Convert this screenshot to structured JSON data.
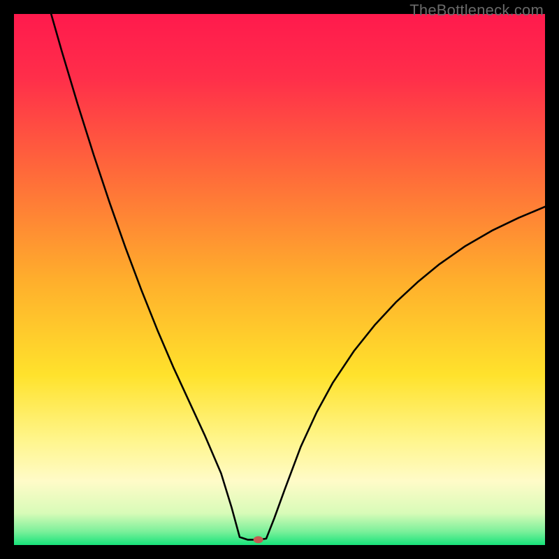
{
  "watermark": "TheBottleneck.com",
  "chart_data": {
    "type": "line",
    "title": "",
    "xlabel": "",
    "ylabel": "",
    "xlim": [
      0,
      100
    ],
    "ylim": [
      0,
      100
    ],
    "grid": false,
    "legend": false,
    "background_gradient_stops": [
      {
        "offset": 0.0,
        "color": "#ff1a4d"
      },
      {
        "offset": 0.12,
        "color": "#ff2e4a"
      },
      {
        "offset": 0.3,
        "color": "#ff6a3a"
      },
      {
        "offset": 0.5,
        "color": "#ffae2c"
      },
      {
        "offset": 0.68,
        "color": "#ffe22c"
      },
      {
        "offset": 0.8,
        "color": "#fff58a"
      },
      {
        "offset": 0.88,
        "color": "#fffbc8"
      },
      {
        "offset": 0.94,
        "color": "#d8fbb8"
      },
      {
        "offset": 0.975,
        "color": "#7af09a"
      },
      {
        "offset": 1.0,
        "color": "#17e37a"
      }
    ],
    "series": [
      {
        "name": "left-branch",
        "x": [
          7.0,
          9.0,
          12.0,
          15.0,
          18.0,
          21.0,
          24.0,
          27.0,
          30.0,
          33.0,
          36.0,
          39.0,
          41.0,
          42.5
        ],
        "y": [
          100.0,
          93.0,
          83.0,
          73.5,
          64.5,
          56.0,
          48.0,
          40.5,
          33.5,
          27.0,
          20.5,
          13.5,
          7.0,
          1.5
        ]
      },
      {
        "name": "valley-floor",
        "x": [
          42.5,
          44.0,
          46.0,
          47.5
        ],
        "y": [
          1.5,
          1.0,
          1.0,
          1.2
        ]
      },
      {
        "name": "right-branch",
        "x": [
          47.5,
          49.0,
          51.0,
          54.0,
          57.0,
          60.0,
          64.0,
          68.0,
          72.0,
          76.0,
          80.0,
          85.0,
          90.0,
          95.0,
          100.0
        ],
        "y": [
          1.2,
          5.0,
          10.5,
          18.5,
          25.0,
          30.5,
          36.5,
          41.5,
          45.8,
          49.5,
          52.8,
          56.3,
          59.2,
          61.6,
          63.7
        ]
      }
    ],
    "marker": {
      "name": "valley-marker",
      "x": 46.0,
      "y": 1.0,
      "color": "#c65a52",
      "rx": 7,
      "ry": 5
    }
  }
}
